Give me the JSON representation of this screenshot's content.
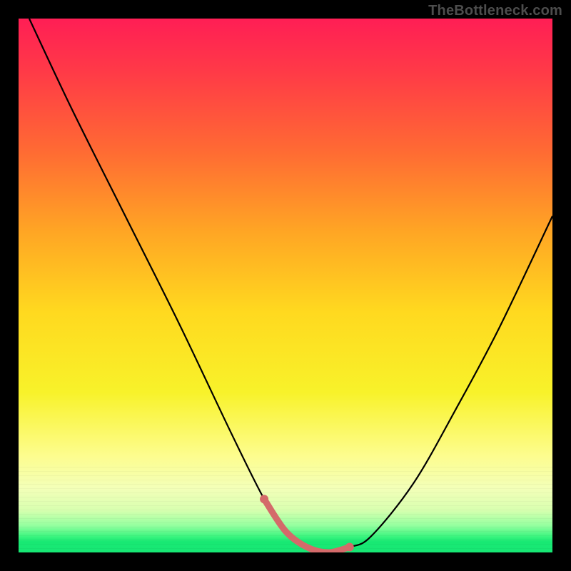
{
  "watermark": "TheBottleneck.com",
  "chart_data": {
    "type": "line",
    "title": "",
    "xlabel": "",
    "ylabel": "",
    "xlim": [
      0,
      100
    ],
    "ylim": [
      0,
      100
    ],
    "grid": false,
    "legend": false,
    "series": [
      {
        "name": "bottleneck-curve",
        "x": [
          2,
          10,
          20,
          30,
          40,
          46,
          50,
          54,
          58,
          62,
          66,
          74,
          82,
          90,
          100
        ],
        "values": [
          100,
          83,
          63,
          43,
          22,
          10,
          4,
          1,
          0,
          1,
          3,
          13,
          27,
          42,
          63
        ]
      }
    ],
    "annotations": [
      {
        "name": "optimal-range",
        "x_start": 46,
        "x_end": 64,
        "style": "highlight"
      }
    ],
    "background_gradient": {
      "top": "#ff1e55",
      "mid": "#ffd91f",
      "bottom": "#17e774"
    }
  }
}
